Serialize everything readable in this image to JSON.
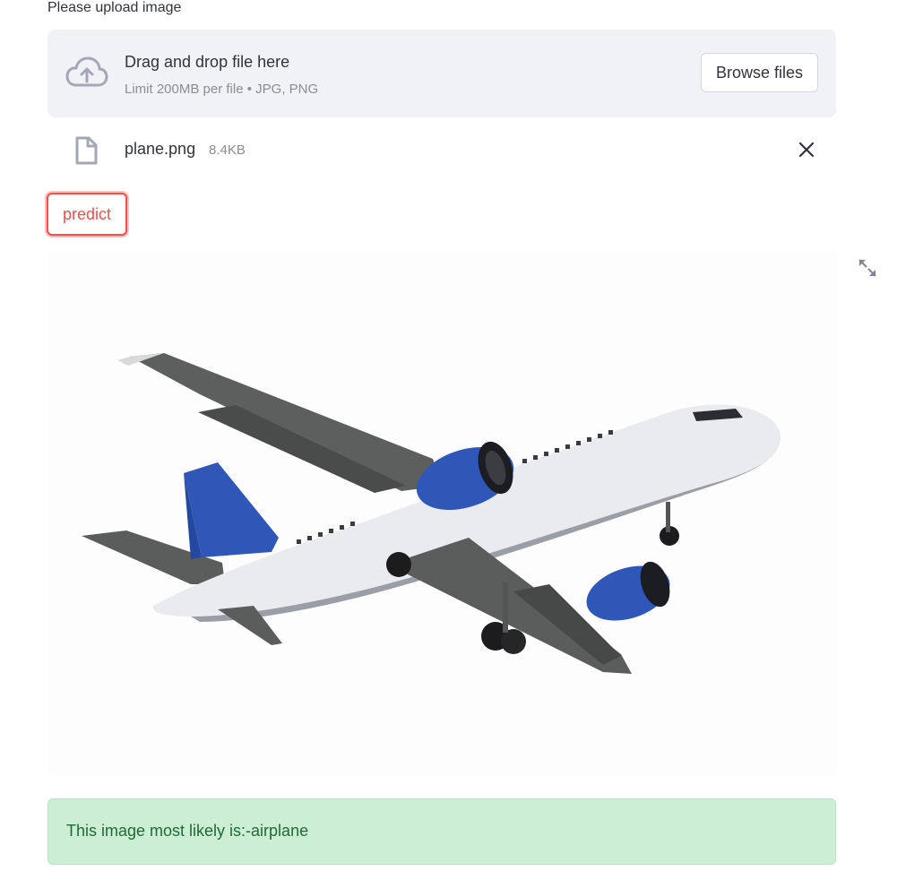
{
  "uploader": {
    "label": "Please upload image",
    "drop_title": "Drag and drop file here",
    "drop_subtitle": "Limit 200MB per file • JPG, PNG",
    "browse_label": "Browse files"
  },
  "file": {
    "name": "plane.png",
    "size": "8.4KB"
  },
  "predict_label": "predict",
  "result": {
    "text": "This image most likely is:-airplane"
  },
  "icons": {
    "upload": "cloud-upload-icon",
    "file": "file-icon",
    "close": "close-icon",
    "expand": "fullscreen-expand-icon"
  },
  "colors": {
    "accent": "#ff4b4b",
    "success_bg": "#cbeed5",
    "success_text": "#1f6b34",
    "dropzone_bg": "#f0f2f6"
  }
}
